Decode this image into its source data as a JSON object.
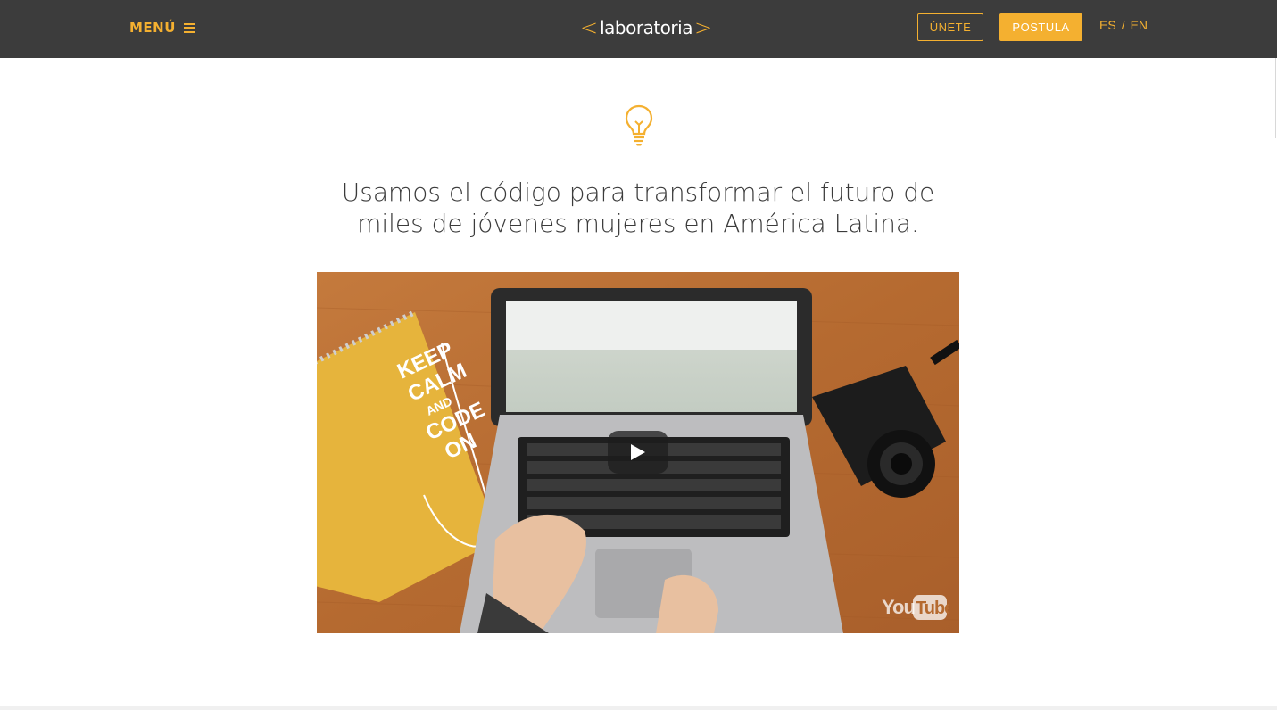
{
  "header": {
    "menu_label": "MENÚ",
    "logo": {
      "bracket_open": "<",
      "text": "laboratoria",
      "bracket_close": ">"
    },
    "join_button": "ÚNETE",
    "apply_button": "POSTULA",
    "languages": {
      "es": "ES",
      "separator": "/",
      "en": "EN"
    }
  },
  "main": {
    "headline": "Usamos el código para transformar el futuro de miles de jóvenes mujeres en América Latina.",
    "icon": "lightbulb-icon",
    "video": {
      "notebook_text": [
        "KEEP",
        "CALM",
        "AND",
        "CODE",
        "ON"
      ],
      "player_logo": "YouTube"
    }
  },
  "colors": {
    "accent": "#f4b030",
    "header_bg": "#3c3c3c",
    "text": "#3b3b3b",
    "video_bg": "#b8692e"
  }
}
